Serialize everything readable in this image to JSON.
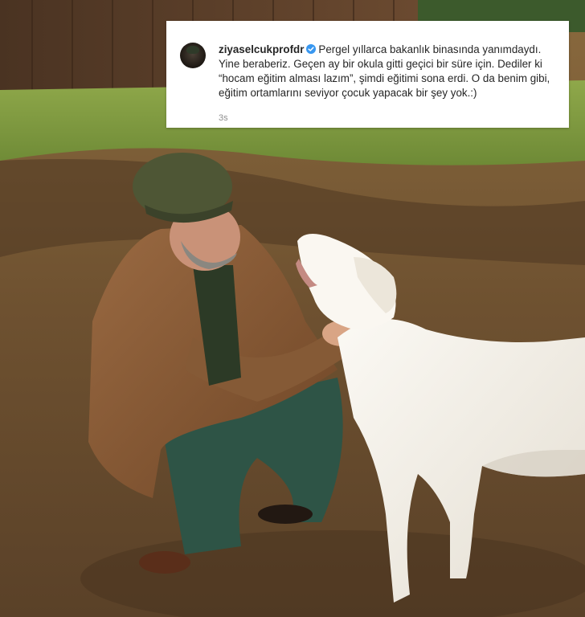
{
  "post": {
    "username": "ziyaselcukprofdr",
    "caption": "Pergel yıllarca bakanlık binasında yanımdaydı. Yine beraberiz. Geçen ay bir okula gitti geçici bir süre için. Dediler ki “hocam eğitim alması lazım”, şimdi eğitimi sona erdi. O da benim gibi, eğitim ortamlarını seviyor çocuk yapacak bir şey yok.:)",
    "timestamp": "3s",
    "verified_icon": "verified-badge-icon",
    "accent_color": "#3897f0"
  },
  "photo": {
    "subject": "man-with-white-dog-photo"
  }
}
